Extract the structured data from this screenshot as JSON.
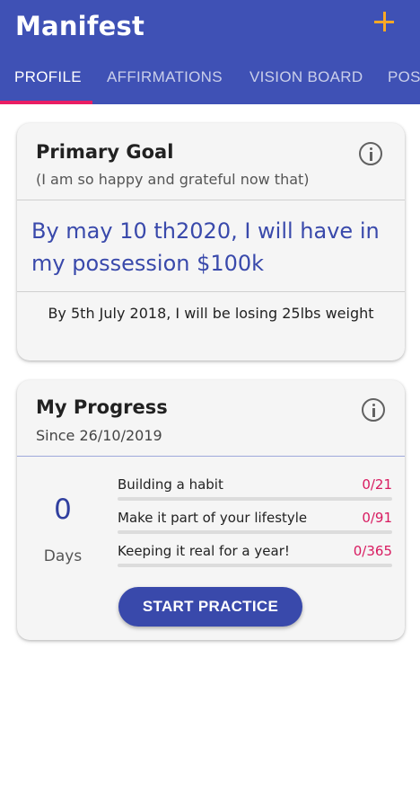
{
  "app": {
    "title": "Manifest",
    "add_icon": "plus-icon",
    "colors": {
      "primary": "#3f51b5",
      "accent": "#f9a825",
      "indicator": "#e91e63",
      "goal_text": "#3949ab",
      "count": "#d81b60"
    }
  },
  "tabs": [
    {
      "label": "PROFILE",
      "active": true
    },
    {
      "label": "AFFIRMATIONS",
      "active": false
    },
    {
      "label": "VISION BOARD",
      "active": false
    },
    {
      "label": "POS",
      "active": false
    }
  ],
  "goal_card": {
    "title": "Primary Goal",
    "subtitle": "(I am so happy and grateful now that)",
    "main_goal": "By may 10 th2020, I will have in my possession $100k",
    "secondary_goal": "By 5th July 2018, I will be losing 25lbs weight",
    "info_icon": "info-icon"
  },
  "progress_card": {
    "title": "My Progress",
    "since": "Since 26/10/2019",
    "days_value": "0",
    "days_label": "Days",
    "info_icon": "info-icon",
    "milestones": [
      {
        "label": "Building a habit",
        "count": "0/21",
        "progress": 0
      },
      {
        "label": "Make it part of your lifestyle",
        "count": "0/91",
        "progress": 0
      },
      {
        "label": "Keeping it real for a year!",
        "count": "0/365",
        "progress": 0
      }
    ],
    "button_label": "START PRACTICE"
  }
}
